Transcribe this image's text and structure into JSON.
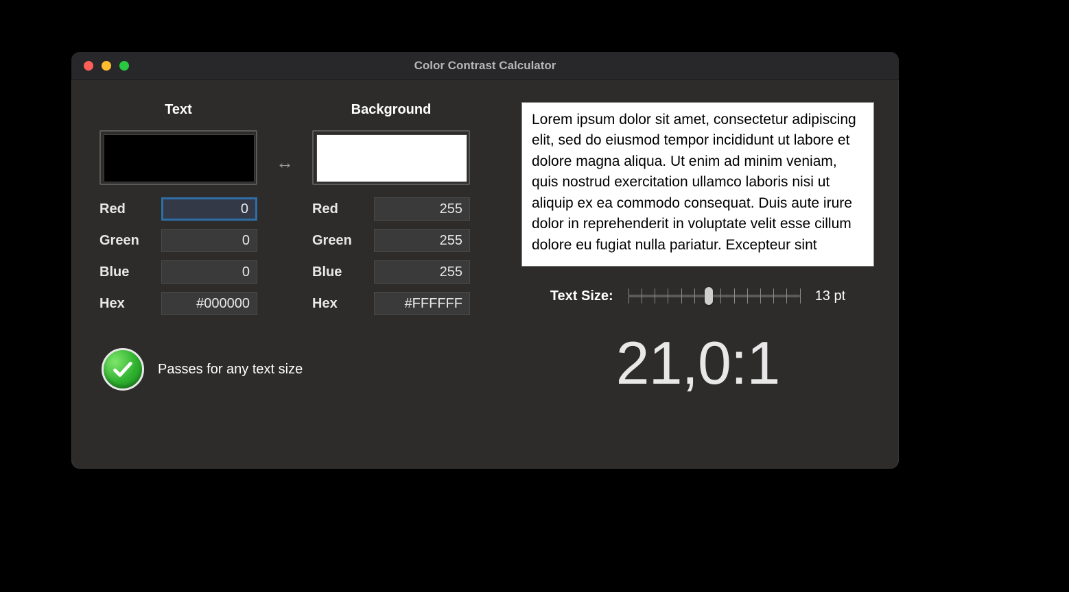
{
  "window": {
    "title": "Color Contrast Calculator"
  },
  "text_color": {
    "heading": "Text",
    "swatch_hex": "#000000",
    "labels": {
      "red": "Red",
      "green": "Green",
      "blue": "Blue",
      "hex": "Hex"
    },
    "values": {
      "red": "0",
      "green": "0",
      "blue": "0",
      "hex": "#000000"
    }
  },
  "background_color": {
    "heading": "Background",
    "swatch_hex": "#FFFFFF",
    "labels": {
      "red": "Red",
      "green": "Green",
      "blue": "Blue",
      "hex": "Hex"
    },
    "values": {
      "red": "255",
      "green": "255",
      "blue": "255",
      "hex": "#FFFFFF"
    }
  },
  "result": {
    "message": "Passes for any text size"
  },
  "preview": {
    "text": "Lorem ipsum dolor sit amet, consectetur adipiscing elit, sed do eiusmod tempor incididunt ut labore et dolore magna aliqua. Ut enim ad minim veniam, quis nostrud exercitation ullamco laboris nisi ut aliquip ex ea commodo consequat. Duis aute irure dolor in reprehenderit in voluptate velit esse cillum dolore eu fugiat nulla pariatur. Excepteur sint"
  },
  "text_size": {
    "label": "Text Size:",
    "value_label": "13 pt",
    "value": 13,
    "min": 9,
    "max": 24
  },
  "ratio": {
    "display": "21,0:1"
  }
}
